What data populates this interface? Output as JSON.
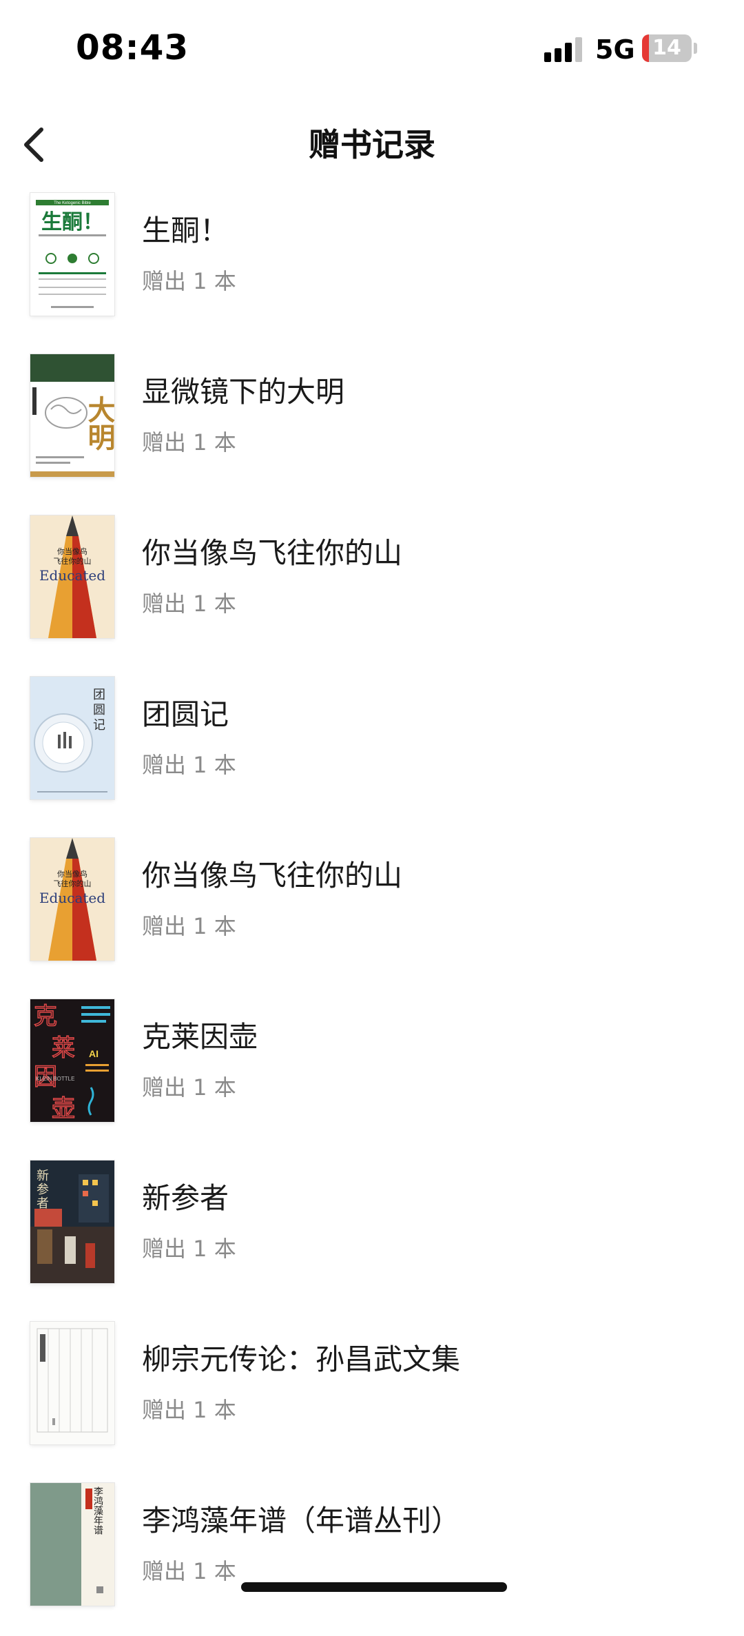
{
  "status_bar": {
    "time": "08:43",
    "network": "5G",
    "battery_level": "14",
    "battery_fraction": 0.14
  },
  "nav": {
    "title": "赠书记录",
    "back_icon": "chevron-left-icon"
  },
  "books": [
    {
      "title": "生酮！",
      "detail": "赠出 1 本",
      "cover_text": [
        "The Ketogenic Bible",
        "生酮！"
      ]
    },
    {
      "title": "显微镜下的大明",
      "detail": "赠出 1 本",
      "cover_text": [
        "大明"
      ]
    },
    {
      "title": "你当像鸟飞往你的山",
      "detail": "赠出 1 本",
      "cover_text": [
        "你当像鸟",
        "飞往你的山",
        "Educated"
      ]
    },
    {
      "title": "团圆记",
      "detail": "赠出 1 本",
      "cover_text": [
        "团",
        "圆",
        "记"
      ]
    },
    {
      "title": "你当像鸟飞往你的山",
      "detail": "赠出 1 本",
      "cover_text": [
        "你当像鸟",
        "飞往你的山",
        "Educated"
      ]
    },
    {
      "title": "克莱因壶",
      "detail": "赠出 1 本",
      "cover_text": [
        "克",
        "莱",
        "因",
        "壶",
        "KLEIN BOTTLE",
        "AI"
      ]
    },
    {
      "title": "新参者",
      "detail": "赠出 1 本",
      "cover_text": [
        "新",
        "参",
        "者"
      ]
    },
    {
      "title": "柳宗元传论：孙昌武文集",
      "detail": "赠出 1 本",
      "cover_text": []
    },
    {
      "title": "李鸿藻年谱（年谱丛刊）",
      "detail": "赠出 1 本",
      "cover_text": [
        "李鸿藻年谱"
      ]
    }
  ]
}
